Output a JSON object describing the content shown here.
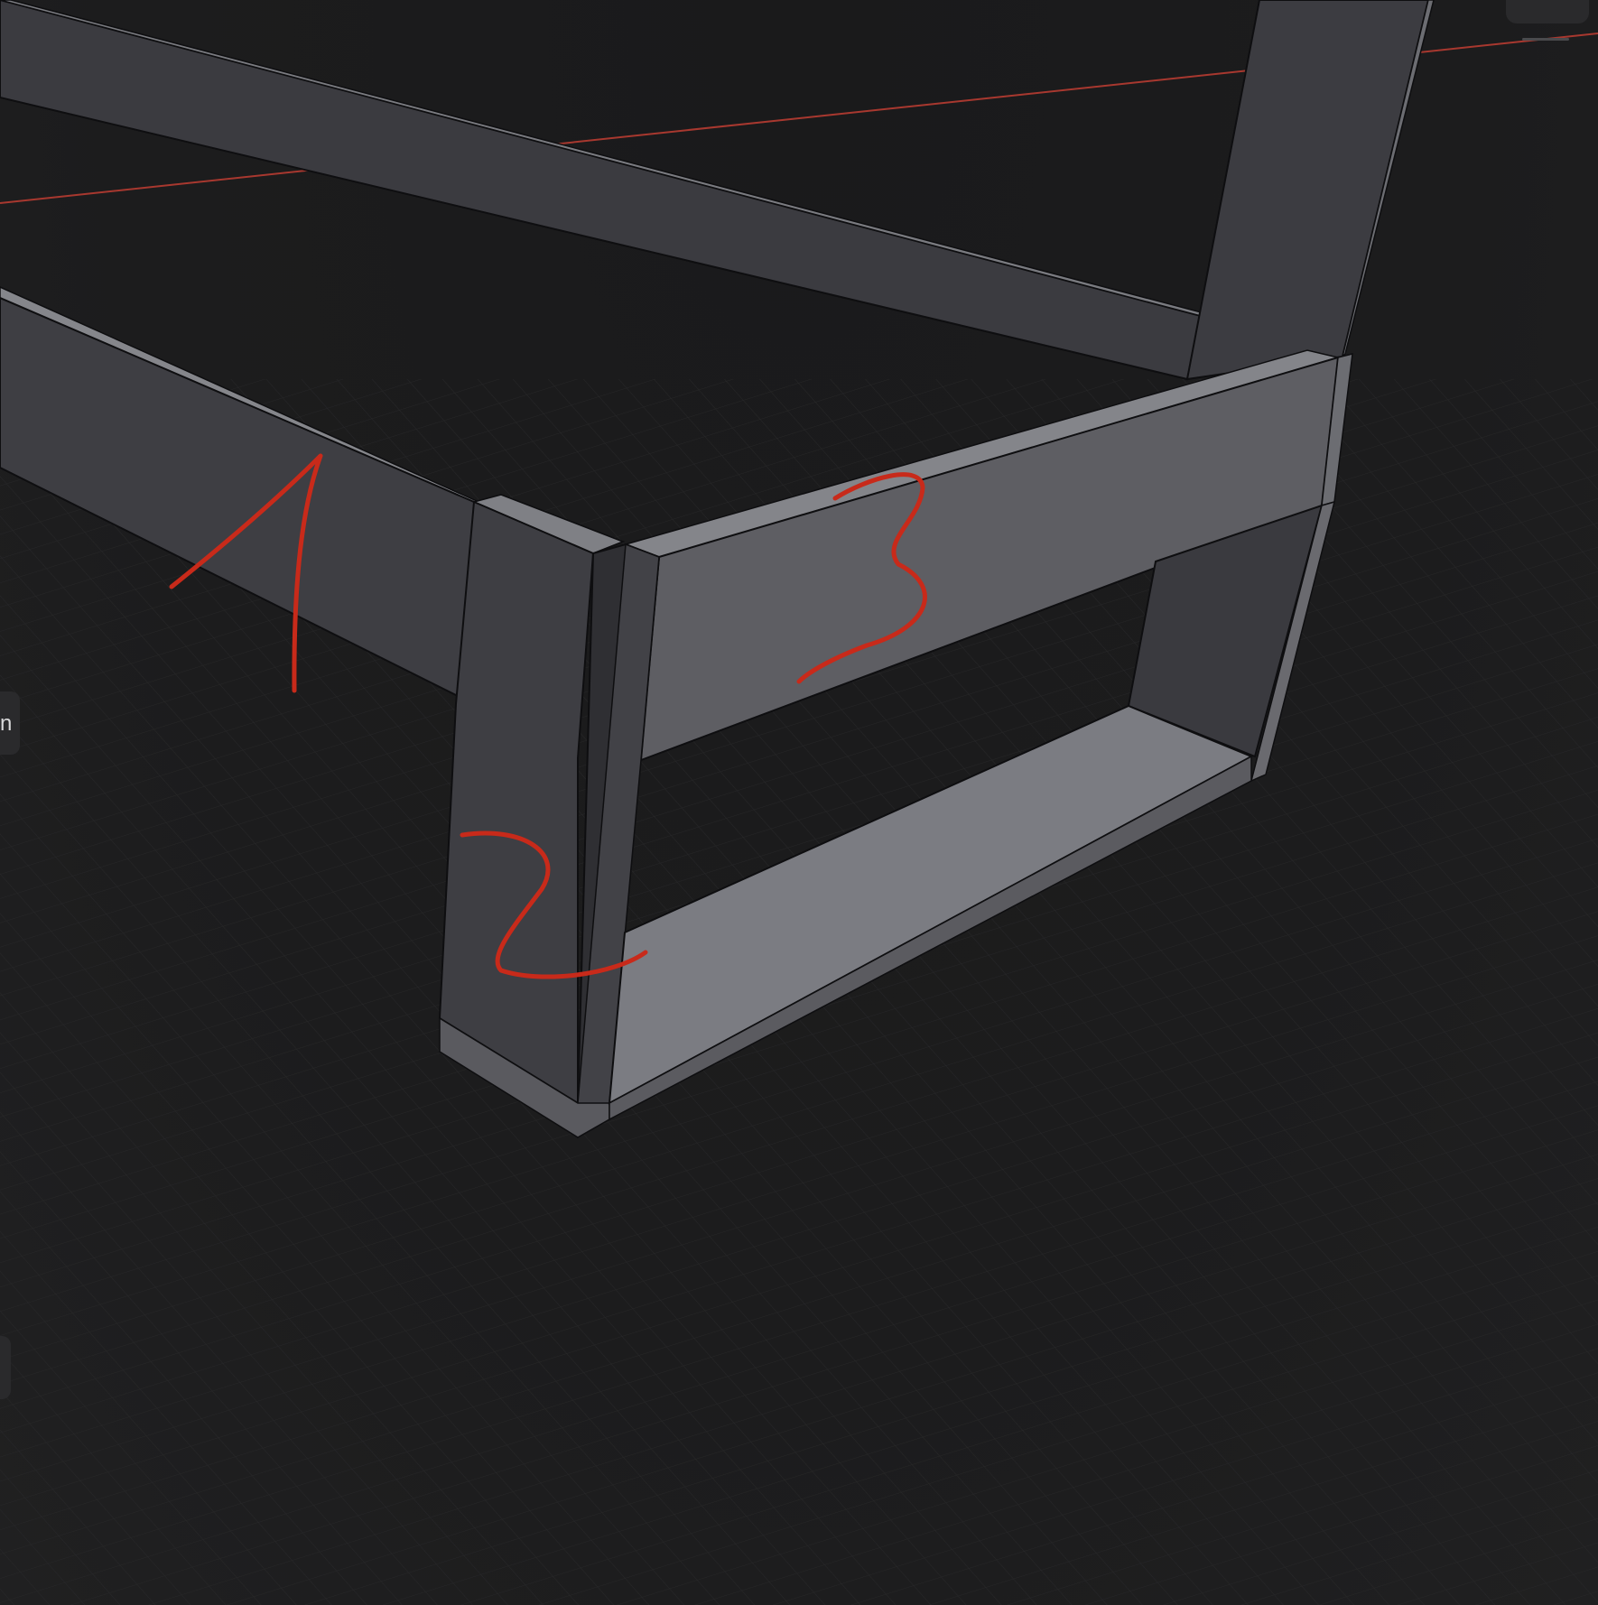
{
  "viewport": {
    "background_color": "#1c1c1d",
    "grid_color": "#2a2a2b",
    "axis_color": "#b5372e",
    "model_colors": {
      "top_face": "#74767c",
      "front_face": "#5d5d62",
      "side_face": "#3a3a3f",
      "inner_face": "#7b7c82",
      "edge": "#0e0e10"
    },
    "annotation_color": "#c82a1a"
  },
  "annotations": [
    "1",
    "2",
    "3"
  ],
  "side_panel": {
    "tab_label": "n"
  },
  "top_right": {
    "button_icon": "menu-icon"
  }
}
